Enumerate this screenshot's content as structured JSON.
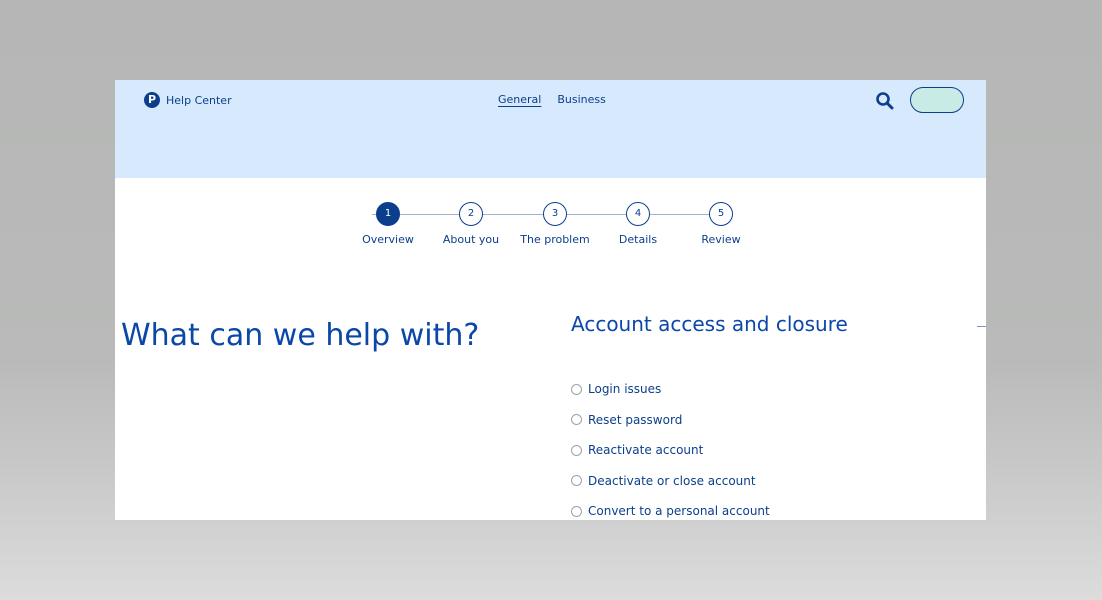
{
  "header": {
    "brand": "Help Center",
    "nav": [
      {
        "label": "General",
        "active": true
      },
      {
        "label": "Business",
        "active": false
      }
    ],
    "search_icon": "search-icon",
    "colors": {
      "header_bg": "#d6e9fd",
      "brand_blue": "#0b3f8c",
      "pill_fill": "#c9ebe6"
    }
  },
  "stepper": {
    "steps": [
      {
        "number": "1",
        "label": "Overview",
        "current": true
      },
      {
        "number": "2",
        "label": "About you",
        "current": false
      },
      {
        "number": "3",
        "label": "The problem",
        "current": false
      },
      {
        "number": "4",
        "label": "Details",
        "current": false
      },
      {
        "number": "5",
        "label": "Review",
        "current": false
      }
    ]
  },
  "main": {
    "heading": "What can we help with?",
    "section_title": "Account access and closure",
    "options": [
      "Login issues",
      "Reset password",
      "Reactivate account",
      "Deactivate or close account",
      "Convert to a personal account"
    ]
  }
}
